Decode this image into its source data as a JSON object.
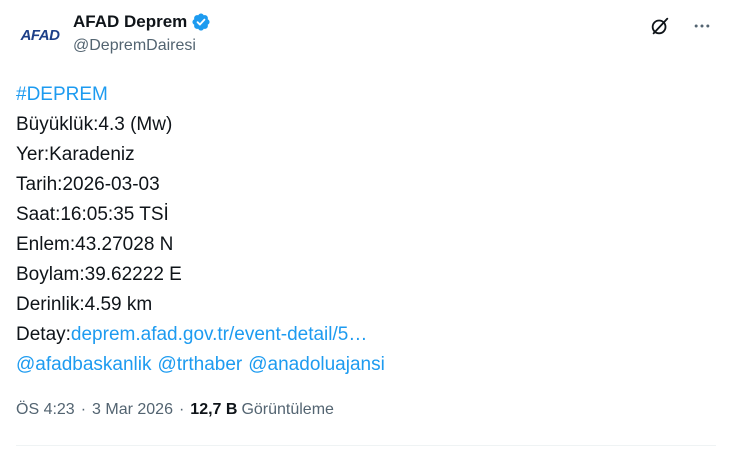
{
  "author": {
    "avatar_text": "AFAD",
    "display_name": "AFAD Deprem",
    "handle": "@DepremDairesi",
    "verified": true
  },
  "post": {
    "hashtag": "#DEPREM",
    "lines": {
      "magnitude": "Büyüklük:4.3 (Mw)",
      "location": "Yer:Karadeniz",
      "date": "Tarih:2026-03-03",
      "time": "Saat:16:05:35 TSİ",
      "latitude": "Enlem:43.27028 N",
      "longitude": "Boylam:39.62222 E",
      "depth": "Derinlik:4.59 km"
    },
    "detail_label": "Detay:",
    "detail_link": "deprem.afad.gov.tr/event-detail/5…",
    "mentions": [
      "@afadbaskanlik",
      "@trthaber",
      "@anadoluajansi"
    ]
  },
  "meta": {
    "time": "ÖS 4:23",
    "date": "3 Mar 2026",
    "separator": "·",
    "views_count": "12,7 B",
    "views_label": "Görüntüleme"
  },
  "colors": {
    "link": "#1d9bf0",
    "text": "#0f1419",
    "secondary": "#536471",
    "verified": "#1d9bf0"
  },
  "icons": {
    "grok": "grok-icon",
    "more": "more-icon",
    "verified": "verified-badge-icon"
  }
}
